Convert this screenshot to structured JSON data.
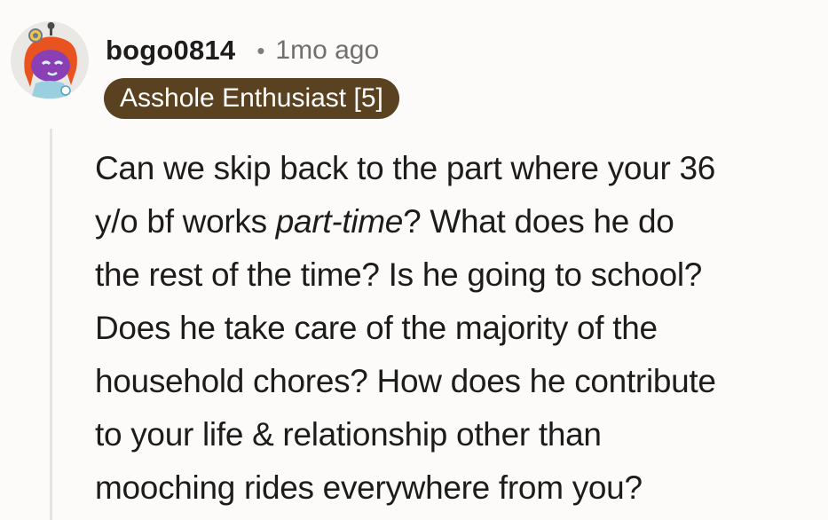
{
  "comment": {
    "username": "bogo0814",
    "separator": "•",
    "timestamp": "1mo ago",
    "flair": "Asshole Enthusiast [5]",
    "avatar_icon": "snoo-avatar-icon",
    "body_lines": [
      {
        "before": "Can we skip back to the part where your 36",
        "emph": "",
        "after": ""
      },
      {
        "before": "y/o bf works ",
        "emph": "part-time",
        "after": "? What does he do"
      },
      {
        "before": "the rest of the time? Is he going to school?",
        "emph": "",
        "after": ""
      },
      {
        "before": "Does he take care of the majority of the",
        "emph": "",
        "after": ""
      },
      {
        "before": "household chores? How does he contribute",
        "emph": "",
        "after": ""
      },
      {
        "before": "to your life & relationship other than",
        "emph": "",
        "after": ""
      },
      {
        "before": "mooching rides everywhere from you?",
        "emph": "",
        "after": ""
      }
    ]
  },
  "colors": {
    "background": "#fcfbfa",
    "flair_background": "#5a4221",
    "flair_text": "#ffffff",
    "thread_line": "#e3e3e3"
  }
}
